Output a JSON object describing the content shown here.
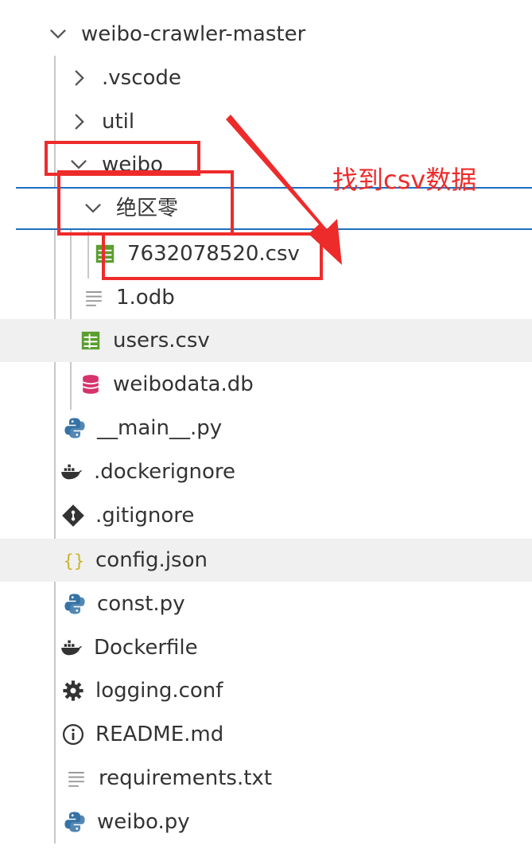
{
  "explorer": {
    "root": {
      "label": "weibo-crawler-master",
      "icon": "chevron-down-icon"
    },
    "items": [
      {
        "label": ".vscode",
        "icon": "chevron-right-icon"
      },
      {
        "label": "util",
        "icon": "chevron-right-icon"
      },
      {
        "label": "weibo",
        "icon": "chevron-down-icon"
      },
      {
        "label": "绝区零",
        "icon": "chevron-down-icon"
      },
      {
        "label": "7632078520.csv",
        "icon": "csv-file-icon"
      },
      {
        "label": "1.odb",
        "icon": "text-file-icon"
      },
      {
        "label": "users.csv",
        "icon": "csv-file-icon"
      },
      {
        "label": "weibodata.db",
        "icon": "database-icon"
      },
      {
        "label": "__main__.py",
        "icon": "python-icon"
      },
      {
        "label": ".dockerignore",
        "icon": "docker-icon"
      },
      {
        "label": ".gitignore",
        "icon": "git-icon"
      },
      {
        "label": "config.json",
        "icon": "json-icon"
      },
      {
        "label": "const.py",
        "icon": "python-icon"
      },
      {
        "label": "Dockerfile",
        "icon": "docker-icon"
      },
      {
        "label": "logging.conf",
        "icon": "gear-icon"
      },
      {
        "label": "README.md",
        "icon": "info-icon"
      },
      {
        "label": "requirements.txt",
        "icon": "text-file-icon"
      },
      {
        "label": "weibo.py",
        "icon": "python-icon"
      }
    ]
  },
  "annotation": {
    "text": "找到csv数据",
    "color": "#ee2b2b"
  },
  "colors": {
    "python_blue": "#3572a5",
    "csv_green": "#5a9e2f",
    "db_pink": "#d6336c",
    "json_yellow": "#c9b52c",
    "selection_border": "#1f6fbf"
  }
}
